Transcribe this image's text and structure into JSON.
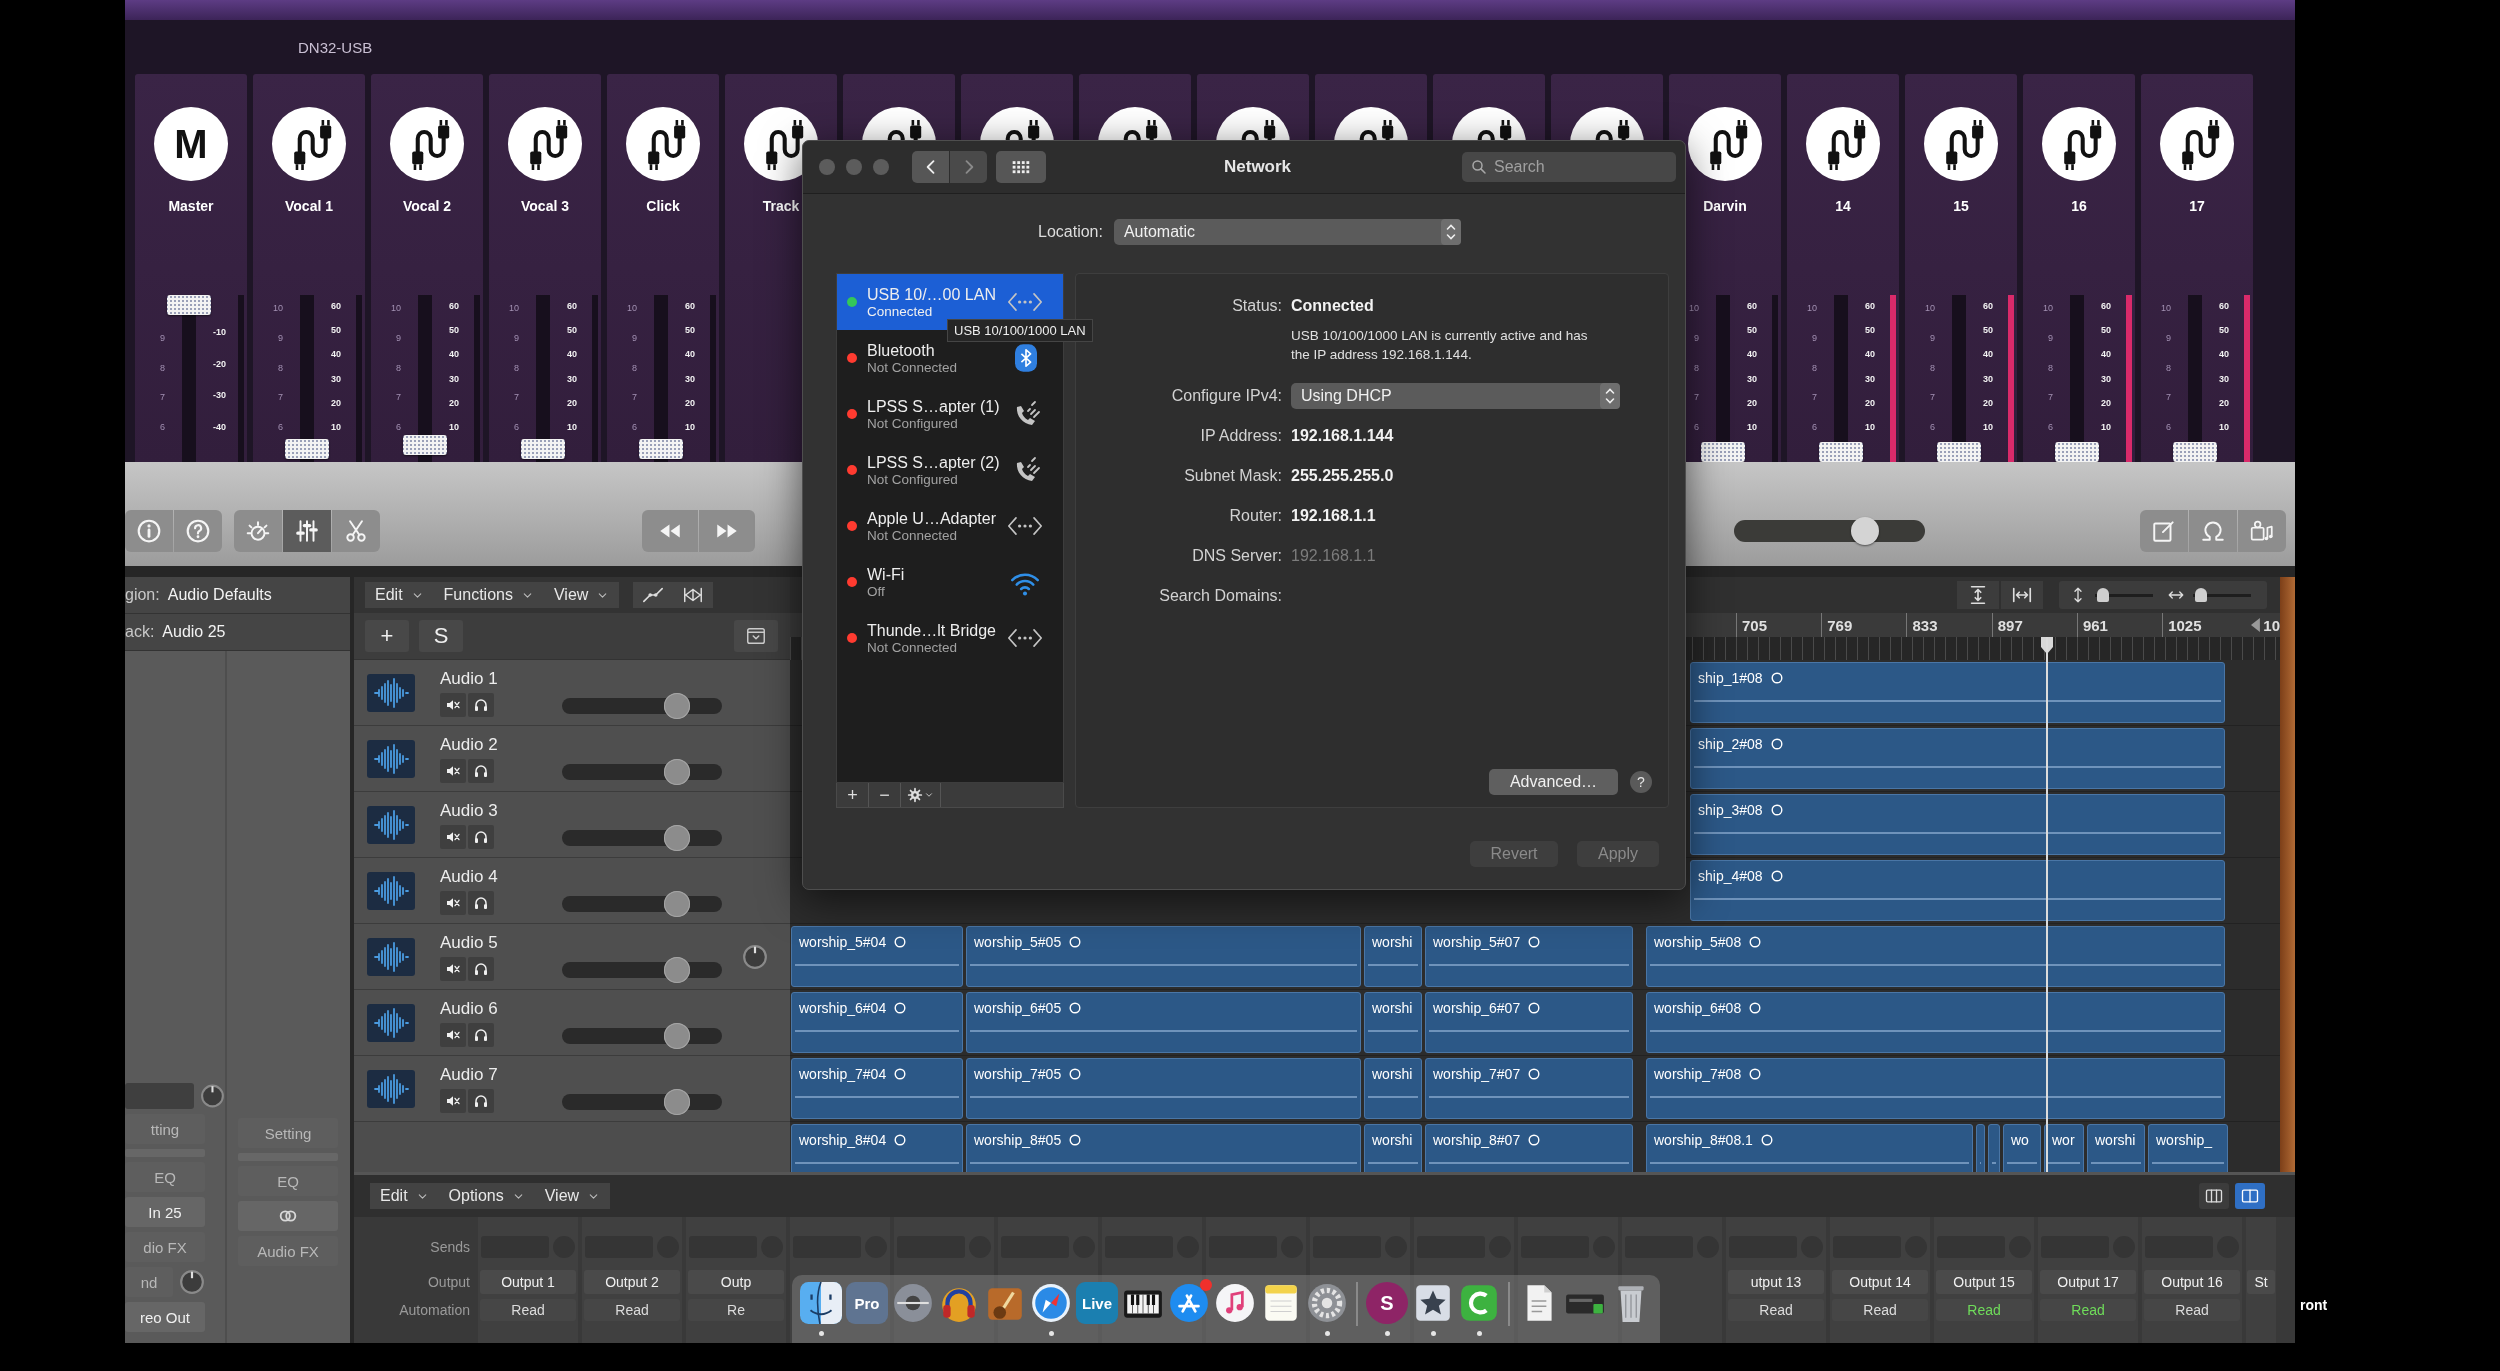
{
  "mixer_app": {
    "title": "DN32-USB",
    "strips": [
      {
        "kind": "master",
        "name": "Master",
        "badge": "M",
        "fader": {
          "level": 1
        },
        "gain_scale": [
          "9",
          "8",
          "7",
          "6"
        ],
        "db_scale": [
          "-10",
          "-20",
          "-30",
          "-40"
        ]
      },
      {
        "kind": "input",
        "name": "Vocal 1",
        "fader": {
          "level": 0.02
        },
        "gain_scale": [
          "10",
          "9",
          "8",
          "7",
          "6"
        ],
        "db_scale": [
          "60",
          "50",
          "40",
          "30",
          "20",
          "10"
        ]
      },
      {
        "kind": "input",
        "name": "Vocal 2",
        "fader": {
          "level": 0.05
        },
        "gain_scale": [
          "10",
          "9",
          "8",
          "7",
          "6"
        ],
        "db_scale": [
          "60",
          "50",
          "40",
          "30",
          "20",
          "10"
        ]
      },
      {
        "kind": "input",
        "name": "Vocal 3",
        "fader": {
          "level": 0.02
        },
        "gain_scale": [
          "10",
          "9",
          "8",
          "7",
          "6"
        ],
        "db_scale": [
          "60",
          "50",
          "40",
          "30",
          "20",
          "10"
        ]
      },
      {
        "kind": "input",
        "name": "Click",
        "fader": {
          "level": 0.02
        },
        "gain_scale": [
          "10",
          "9",
          "8",
          "7",
          "6"
        ],
        "db_scale": [
          "60",
          "50",
          "40",
          "30",
          "20",
          "10"
        ]
      },
      {
        "kind": "input",
        "name": "Track"
      },
      {
        "kind": "input"
      },
      {
        "kind": "input"
      },
      {
        "kind": "input"
      },
      {
        "kind": "input"
      },
      {
        "kind": "input"
      },
      {
        "kind": "input"
      },
      {
        "kind": "input"
      },
      {
        "kind": "input",
        "name": "Darvin",
        "fader": {
          "level": 0
        },
        "gain_scale": [
          "10",
          "9",
          "8",
          "7",
          "6"
        ],
        "db_scale": [
          "60",
          "50",
          "40",
          "30",
          "20",
          "10"
        ]
      },
      {
        "kind": "input",
        "name": "14",
        "fader": {
          "level": 0
        },
        "meter": {
          "level": 1
        },
        "gain_scale": [
          "10",
          "9",
          "8",
          "7",
          "6"
        ],
        "db_scale": [
          "60",
          "50",
          "40",
          "30",
          "20",
          "10"
        ]
      },
      {
        "kind": "input",
        "name": "15",
        "fader": {
          "level": 0
        },
        "meter": {
          "level": 1
        },
        "gain_scale": [
          "10",
          "9",
          "8",
          "7",
          "6"
        ],
        "db_scale": [
          "60",
          "50",
          "40",
          "30",
          "20",
          "10"
        ]
      },
      {
        "kind": "input",
        "name": "16",
        "fader": {
          "level": 0
        },
        "meter": {
          "level": 1
        },
        "gain_scale": [
          "10",
          "9",
          "8",
          "7",
          "6"
        ],
        "db_scale": [
          "60",
          "50",
          "40",
          "30",
          "20",
          "10"
        ]
      },
      {
        "kind": "input",
        "name": "17",
        "fader": {
          "level": 0
        },
        "meter": {
          "level": 1
        },
        "gain_scale": [
          "10",
          "9",
          "8",
          "7",
          "6"
        ],
        "db_scale": [
          "60",
          "50",
          "40",
          "30",
          "20",
          "10"
        ]
      }
    ]
  },
  "daw": {
    "control_bar": {
      "help_buttons": [
        {
          "kind": "info"
        },
        {
          "kind": "help"
        }
      ],
      "tool_buttons": [
        {
          "kind": "dial",
          "selected": false
        },
        {
          "kind": "sliders",
          "selected": true
        },
        {
          "kind": "scissors",
          "selected": false
        }
      ],
      "transport": [
        {
          "kind": "rewind"
        },
        {
          "kind": "forward"
        }
      ],
      "master_volume": {
        "level": 0.72
      },
      "view_buttons": [
        {
          "kind": "notepad"
        },
        {
          "kind": "loop"
        },
        {
          "kind": "browser"
        }
      ]
    },
    "inspector": {
      "region_label": "gion:",
      "region_value": "Audio Defaults",
      "track_label": "ack:",
      "track_value": "Audio 25",
      "left_controls": [
        {
          "kind": "slot"
        },
        {
          "kind": "button",
          "label": "tting",
          "dimmed": true
        },
        {
          "kind": "bar"
        },
        {
          "kind": "button",
          "label": "EQ",
          "dimmed": true
        },
        {
          "kind": "button",
          "label": "In 25",
          "dimmed": false
        },
        {
          "kind": "button",
          "label": "dio FX",
          "dimmed": true
        },
        {
          "kind": "send",
          "label": "nd",
          "dimmed": true
        },
        {
          "kind": "button",
          "label": "reo Out",
          "dimmed": false
        }
      ],
      "right_controls": [
        {
          "kind": "button",
          "label": "Setting",
          "dimmed": true
        },
        {
          "kind": "bar"
        },
        {
          "kind": "button",
          "label": "EQ",
          "dimmed": true
        },
        {
          "kind": "link"
        },
        {
          "kind": "button",
          "label": "Audio FX",
          "dimmed": true
        }
      ]
    },
    "tracks": {
      "menus": [
        {
          "label": "Edit"
        },
        {
          "label": "Functions"
        },
        {
          "label": "View"
        }
      ],
      "add_label": "+",
      "s_label": "S",
      "rows": [
        {
          "name": "Audio 1",
          "volume": {
            "level": 0.76
          },
          "pan_knob": false
        },
        {
          "name": "Audio 2",
          "volume": {
            "level": 0.76
          },
          "pan_knob": false
        },
        {
          "name": "Audio 3",
          "volume": {
            "level": 0.76
          },
          "pan_knob": false
        },
        {
          "name": "Audio 4",
          "volume": {
            "level": 0.76
          },
          "pan_knob": false
        },
        {
          "name": "Audio 5",
          "volume": {
            "level": 0.76
          },
          "pan_knob": true
        },
        {
          "name": "Audio 6",
          "volume": {
            "level": 0.76
          },
          "pan_knob": false
        },
        {
          "name": "Audio 7",
          "volume": {
            "level": 0.76
          },
          "pan_knob": false
        }
      ]
    },
    "timeline": {
      "zoom_sliders": [
        {
          "level": 0.05
        },
        {
          "level": 0.05
        }
      ],
      "ruler": {
        "labels": [
          "705",
          "769",
          "833",
          "897",
          "961",
          "1025"
        ],
        "cut_label": "10"
      },
      "lanes": [
        {
          "regions": [
            {
              "name": "ship_1#08",
              "loop_icon": true
            }
          ]
        },
        {
          "regions": [
            {
              "name": "ship_2#08",
              "loop_icon": true
            }
          ]
        },
        {
          "regions": [
            {
              "name": "ship_3#08",
              "loop_icon": true
            }
          ]
        },
        {
          "regions": [
            {
              "name": "ship_4#08",
              "loop_icon": true
            }
          ]
        },
        {
          "regions": [
            {
              "name": "worship_5#04",
              "loop_icon": true
            },
            {
              "name": "worship_5#05",
              "loop_icon": true
            },
            {
              "name": "worshi",
              "loop_icon": false
            },
            {
              "name": "worship_5#07",
              "loop_icon": true
            },
            {
              "name": "worship_5#08",
              "loop_icon": true
            }
          ]
        },
        {
          "regions": [
            {
              "name": "worship_6#04",
              "loop_icon": true
            },
            {
              "name": "worship_6#05",
              "loop_icon": true
            },
            {
              "name": "worshi",
              "loop_icon": false
            },
            {
              "name": "worship_6#07",
              "loop_icon": true
            },
            {
              "name": "worship_6#08",
              "loop_icon": true
            }
          ]
        },
        {
          "regions": [
            {
              "name": "worship_7#04",
              "loop_icon": true
            },
            {
              "name": "worship_7#05",
              "loop_icon": true
            },
            {
              "name": "worshi",
              "loop_icon": false
            },
            {
              "name": "worship_7#07",
              "loop_icon": true
            },
            {
              "name": "worship_7#08",
              "loop_icon": true
            }
          ]
        },
        {
          "regions": [
            {
              "name": "worship_8#04",
              "loop_icon": true
            },
            {
              "name": "worship_8#05",
              "loop_icon": true
            },
            {
              "name": "worshi",
              "loop_icon": false
            },
            {
              "name": "worship_8#07",
              "loop_icon": true
            },
            {
              "name": "worship_8#08.1",
              "loop_icon": true
            },
            {
              "loop_icon": false
            },
            {
              "loop_icon": false
            },
            {
              "name": "wo",
              "loop_icon": false
            },
            {
              "name": "wor",
              "loop_icon": false
            },
            {
              "name": "worshi",
              "loop_icon": false
            },
            {
              "name": "worship_",
              "loop_icon": false
            }
          ]
        }
      ]
    },
    "mixer": {
      "menus": [
        {
          "label": "Edit"
        },
        {
          "label": "Options"
        },
        {
          "label": "View"
        }
      ],
      "view_toggles": [
        {
          "selected": false
        },
        {
          "selected": true
        }
      ],
      "row_labels": [
        "Sends",
        "Output",
        "Automation"
      ],
      "channels": [
        {
          "kind": "full",
          "output": "Output 1",
          "automation": "Read",
          "active": false
        },
        {
          "kind": "full",
          "output": "Output 2",
          "automation": "Read",
          "active": false
        },
        {
          "kind": "full",
          "output": "Outp",
          "automation": "Re",
          "active": false
        },
        {
          "kind": "covered"
        },
        {
          "kind": "covered"
        },
        {
          "kind": "covered"
        },
        {
          "kind": "covered"
        },
        {
          "kind": "covered"
        },
        {
          "kind": "covered"
        },
        {
          "kind": "covered"
        },
        {
          "kind": "covered"
        },
        {
          "kind": "covered"
        },
        {
          "kind": "full",
          "output": "utput 13",
          "automation": "Read",
          "active": false
        },
        {
          "kind": "full",
          "output": "Output 14",
          "automation": "Read",
          "active": false
        },
        {
          "kind": "full",
          "output": "Output 15",
          "automation": "Read",
          "active": true
        },
        {
          "kind": "full",
          "output": "Output 17",
          "automation": "Read",
          "active": true
        },
        {
          "kind": "full",
          "output": "Output 16",
          "automation": "Read",
          "active": false
        },
        {
          "kind": "edge",
          "output": "St"
        }
      ]
    }
  },
  "network": {
    "title": "Network",
    "search_placeholder": "Search",
    "location_label": "Location:",
    "location": "Automatic",
    "services": [
      {
        "name": "USB 10/…00 LAN",
        "status": "Connected",
        "color": "#34c759",
        "kind": "ethernet",
        "selected": true
      },
      {
        "name": "Bluetooth",
        "status": "Not Connected",
        "color": "#ff3b30",
        "kind": "bluetooth",
        "selected": false
      },
      {
        "name": "LPSS S…apter (1)",
        "status": "Not Configured",
        "color": "#ff3b30",
        "kind": "phone",
        "selected": false
      },
      {
        "name": "LPSS S…apter (2)",
        "status": "Not Configured",
        "color": "#ff3b30",
        "kind": "phone",
        "selected": false
      },
      {
        "name": "Apple U…Adapter",
        "status": "Not Connected",
        "color": "#ff3b30",
        "kind": "ethernet",
        "selected": false
      },
      {
        "name": "Wi-Fi",
        "status": "Off",
        "color": "#ff3b30",
        "kind": "wifi",
        "selected": false
      },
      {
        "name": "Thunde…lt Bridge",
        "status": "Not Connected",
        "color": "#ff3b30",
        "kind": "ethernet",
        "selected": false
      }
    ],
    "footer_buttons": [
      "+",
      "−"
    ],
    "tooltip": "USB 10/100/1000 LAN",
    "status_label": "Status:",
    "status": "Connected",
    "status_text": "USB 10/100/1000 LAN is currently active and has the IP address 192.168.1.144.",
    "fields": [
      {
        "kind": "popup",
        "label": "Configure IPv4:",
        "value": "Using DHCP"
      },
      {
        "kind": "value",
        "label": "IP Address:",
        "value": "192.168.1.144",
        "dimmed": false
      },
      {
        "kind": "value",
        "label": "Subnet Mask:",
        "value": "255.255.255.0",
        "dimmed": false
      },
      {
        "kind": "value",
        "label": "Router:",
        "value": "192.168.1.1",
        "dimmed": false
      },
      {
        "kind": "value",
        "label": "DNS Server:",
        "value": "192.168.1.1",
        "dimmed": true
      },
      {
        "kind": "value",
        "label": "Search Domains:"
      }
    ],
    "advanced_button": "Advanced…",
    "help_button": "?",
    "buttons": [
      {
        "kind": "revert",
        "label": "Revert",
        "disabled": true
      },
      {
        "kind": "apply",
        "label": "Apply",
        "disabled": true
      }
    ]
  },
  "dock": {
    "items": [
      {
        "kind": "finder",
        "running": true,
        "badge": false
      },
      {
        "kind": "tile",
        "label": "Pro",
        "color": "#5f7491",
        "running": false,
        "badge": false
      },
      {
        "kind": "dj",
        "running": false,
        "badge": false
      },
      {
        "kind": "headphones",
        "running": false,
        "badge": false
      },
      {
        "kind": "guitar",
        "running": false,
        "badge": false
      },
      {
        "kind": "safari",
        "running": true,
        "badge": false
      },
      {
        "kind": "tile",
        "label": "Live",
        "color": "#1b7fb0",
        "running": false,
        "badge": false
      },
      {
        "kind": "piano",
        "running": false,
        "badge": false
      },
      {
        "kind": "appstore",
        "running": false,
        "badge": true
      },
      {
        "kind": "music",
        "running": false,
        "badge": false
      },
      {
        "kind": "notes",
        "running": false,
        "badge": false
      },
      {
        "kind": "settings",
        "running": true,
        "badge": false
      },
      {
        "kind": "separator"
      },
      {
        "kind": "round_tile",
        "label": "S",
        "color": "#8e2466",
        "running": true,
        "badge": false
      },
      {
        "kind": "star",
        "running": true,
        "badge": false
      },
      {
        "kind": "camtasia",
        "running": true,
        "badge": false
      },
      {
        "kind": "separator"
      },
      {
        "kind": "document",
        "running": false,
        "badge": false
      },
      {
        "kind": "device",
        "running": false,
        "badge": false
      },
      {
        "kind": "trash",
        "running": false,
        "badge": false
      }
    ]
  },
  "desktop_label": "ront"
}
